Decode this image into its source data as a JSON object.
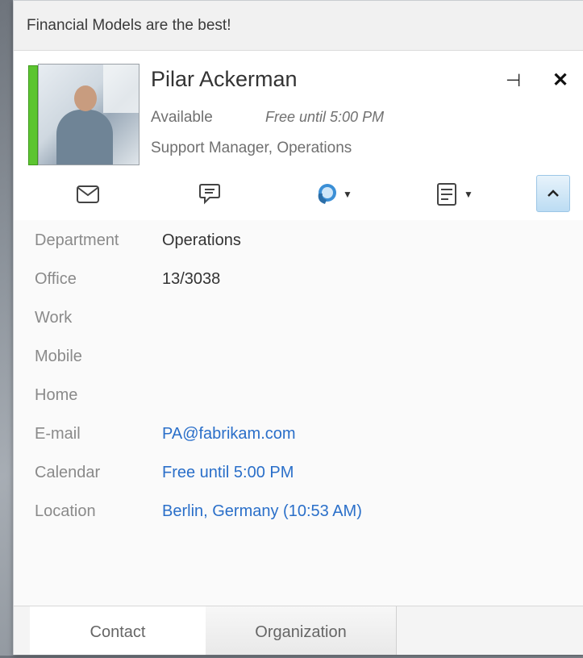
{
  "note": "Financial Models are the best!",
  "contact": {
    "name": "Pilar Ackerman",
    "status": "Available",
    "status_detail": "Free until 5:00 PM",
    "title": "Support Manager, Operations",
    "presence_color": "#5cc530"
  },
  "icons": {
    "pin": "pin-icon",
    "close": "close-icon",
    "email": "email-icon",
    "im": "im-icon",
    "call": "call-icon",
    "schedule": "schedule-icon",
    "collapse": "chevron-up-icon"
  },
  "details": [
    {
      "label": "Department",
      "value": "Operations",
      "link": false
    },
    {
      "label": "Office",
      "value": "13/3038",
      "link": false
    },
    {
      "label": "Work",
      "value": "",
      "link": false
    },
    {
      "label": "Mobile",
      "value": "",
      "link": false
    },
    {
      "label": "Home",
      "value": "",
      "link": false
    },
    {
      "label": "E-mail",
      "value": "PA@fabrikam.com",
      "link": true
    },
    {
      "label": "Calendar",
      "value": "Free until 5:00 PM",
      "link": true
    },
    {
      "label": "Location",
      "value": "Berlin, Germany (10:53 AM)",
      "link": true
    }
  ],
  "tabs": [
    {
      "label": "Contact",
      "active": true
    },
    {
      "label": "Organization",
      "active": false
    }
  ],
  "colors": {
    "link": "#2a6fc9",
    "accent": "#9cc6e6"
  }
}
